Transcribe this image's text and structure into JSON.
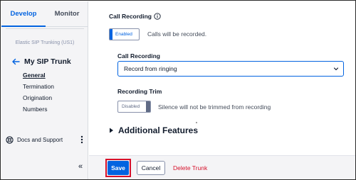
{
  "colors": {
    "accent": "#0263e0",
    "danger": "#d6112b",
    "sidebar_bg": "#f4f4f6",
    "text": "#121c2d"
  },
  "sidebar": {
    "tabs": [
      {
        "label": "Develop",
        "active": true
      },
      {
        "label": "Monitor",
        "active": false
      }
    ],
    "breadcrumb": "Elastic SIP Trunking (US1)",
    "title": "My SIP Trunk",
    "back_icon": "arrow-left-icon",
    "nav_items": [
      {
        "label": "General",
        "active": true
      },
      {
        "label": "Termination",
        "active": false
      },
      {
        "label": "Origination",
        "active": false
      },
      {
        "label": "Numbers",
        "active": false
      }
    ],
    "docs_label": "Docs and Support",
    "docs_icon": "support-icon",
    "more_icon": "kebab-menu-icon",
    "collapse_label": "«"
  },
  "main": {
    "call_recording": {
      "heading": "Call Recording",
      "info_icon": "info-icon",
      "toggle_label": "Enabled",
      "toggle_on": true,
      "description": "Calls will be recorded."
    },
    "recording_select": {
      "label": "Call Recording",
      "value": "Record from ringing",
      "chevron_icon": "chevron-down-icon"
    },
    "recording_trim": {
      "label": "Recording Trim",
      "toggle_label": "Disabled",
      "toggle_on": false,
      "description": "Silence will not be trimmed from recording"
    },
    "additional_features": {
      "title": "Additional Features",
      "caret_icon": "caret-right-icon",
      "expanded": false
    }
  },
  "footer": {
    "save_label": "Save",
    "cancel_label": "Cancel",
    "delete_label": "Delete Trunk"
  }
}
